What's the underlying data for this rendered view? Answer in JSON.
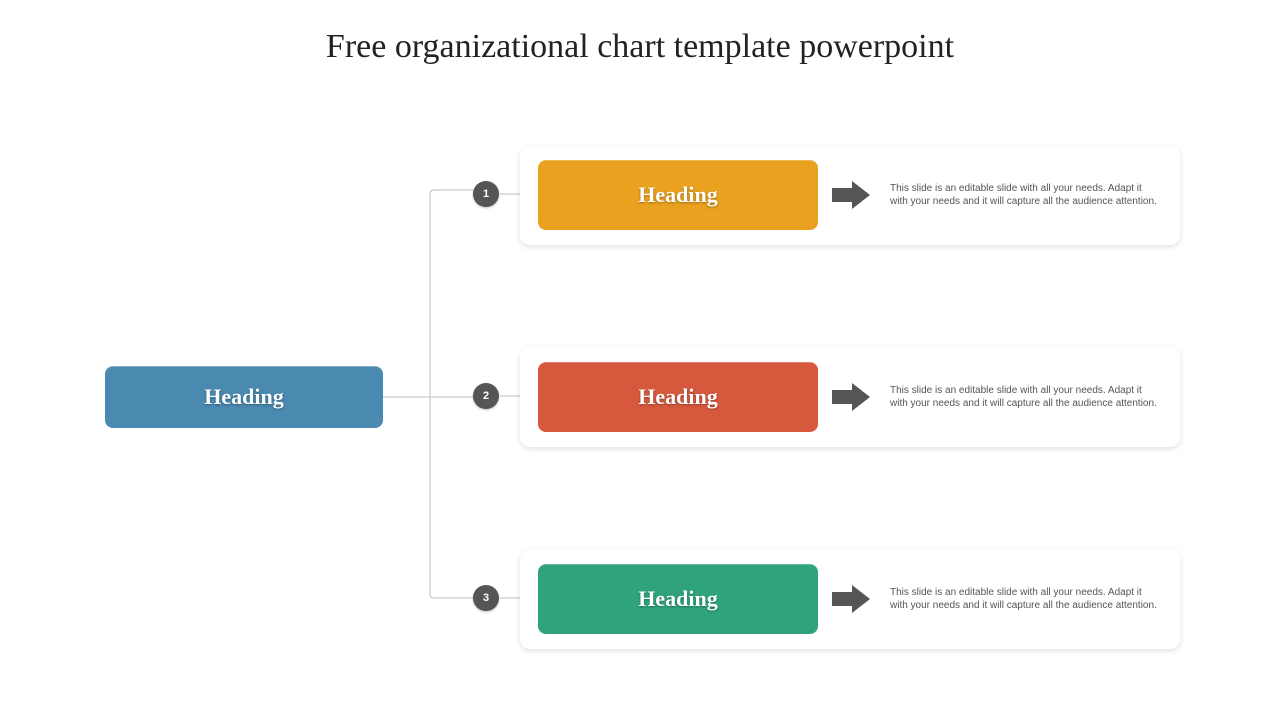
{
  "title": "Free organizational chart template powerpoint",
  "root": {
    "label": "Heading",
    "color": "#4A89B0"
  },
  "items": [
    {
      "num": "1",
      "label": "Heading",
      "color": "#E9A11F",
      "desc": "This slide is an editable slide with all your needs. Adapt it with your needs and it will capture all the audience attention."
    },
    {
      "num": "2",
      "label": "Heading",
      "color": "#D6593D",
      "desc": "This slide is an editable slide with all your needs. Adapt it with your needs and it will capture all the audience attention."
    },
    {
      "num": "3",
      "label": "Heading",
      "color": "#2FA37E",
      "desc": "This slide is an editable slide with all your needs. Adapt it with your needs and it will capture all the audience attention."
    }
  ]
}
